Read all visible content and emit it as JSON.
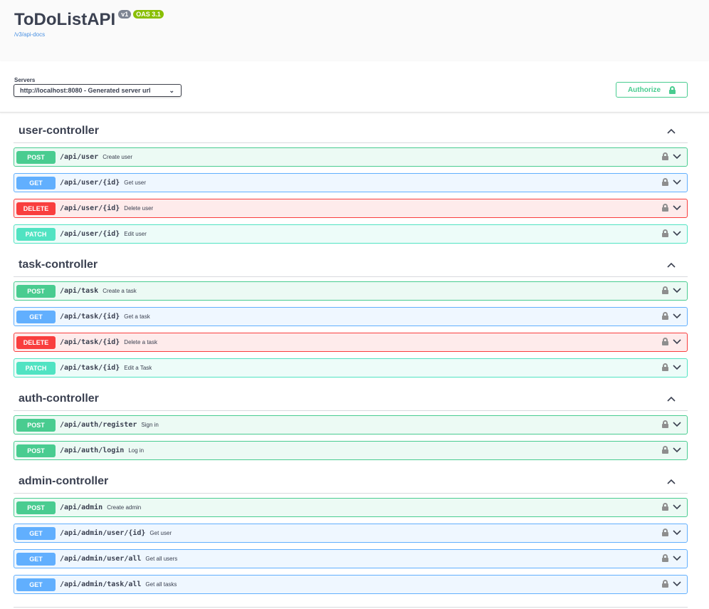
{
  "info": {
    "title": "ToDoListAPI",
    "version": "v1",
    "oas": "OAS 3.1",
    "docs_link": "/v3/api-docs"
  },
  "servers": {
    "label": "Servers",
    "selected": "http://localhost:8080 - Generated server url"
  },
  "authorize": {
    "label": "Authorize"
  },
  "colors": {
    "post": "#49cc90",
    "get": "#61affe",
    "delete": "#f93e3e",
    "patch": "#50e3c2"
  },
  "tags": [
    {
      "name": "user-controller",
      "operations": [
        {
          "method": "POST",
          "path": "/api/user",
          "summary": "Create user"
        },
        {
          "method": "GET",
          "path": "/api/user/{id}",
          "summary": "Get user"
        },
        {
          "method": "DELETE",
          "path": "/api/user/{id}",
          "summary": "Delete user"
        },
        {
          "method": "PATCH",
          "path": "/api/user/{id}",
          "summary": "Edit user"
        }
      ]
    },
    {
      "name": "task-controller",
      "operations": [
        {
          "method": "POST",
          "path": "/api/task",
          "summary": "Create a task"
        },
        {
          "method": "GET",
          "path": "/api/task/{id}",
          "summary": "Get a task"
        },
        {
          "method": "DELETE",
          "path": "/api/task/{id}",
          "summary": "Delete a task"
        },
        {
          "method": "PATCH",
          "path": "/api/task/{id}",
          "summary": "Edit a Task"
        }
      ]
    },
    {
      "name": "auth-controller",
      "operations": [
        {
          "method": "POST",
          "path": "/api/auth/register",
          "summary": "Sign in"
        },
        {
          "method": "POST",
          "path": "/api/auth/login",
          "summary": "Log in"
        }
      ]
    },
    {
      "name": "admin-controller",
      "operations": [
        {
          "method": "POST",
          "path": "/api/admin",
          "summary": "Create admin"
        },
        {
          "method": "GET",
          "path": "/api/admin/user/{id}",
          "summary": "Get user"
        },
        {
          "method": "GET",
          "path": "/api/admin/user/all",
          "summary": "Get all users"
        },
        {
          "method": "GET",
          "path": "/api/admin/task/all",
          "summary": "Get all tasks"
        }
      ]
    }
  ]
}
